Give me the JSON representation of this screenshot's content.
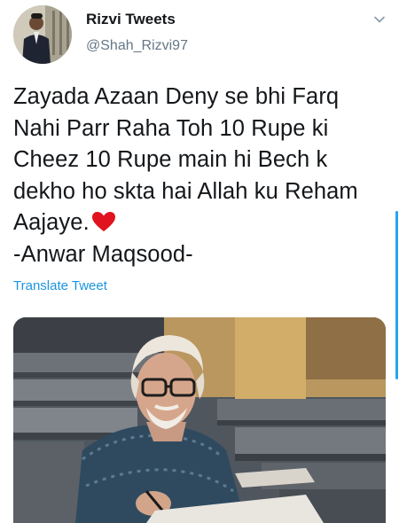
{
  "tweet": {
    "author_name": "Rizvi Tweets",
    "author_handle": "@Shah_Rizvi97",
    "text": "Zayada Azaan Deny se bhi Farq\nNahi Parr Raha Toh 10 Rupe ki\nCheez 10 Rupe main hi Bech k\ndekho ho skta hai Allah ku Reham\nAajaye.",
    "text_signature": "-Anwar Maqsood-",
    "translate_label": "Translate Tweet"
  },
  "icons": {
    "heart": "red-heart-icon",
    "caret": "chevron-down-icon"
  },
  "colors": {
    "text": "#14171a",
    "secondary": "#657786",
    "link": "#1b95e0",
    "heart": "#e0141e"
  }
}
